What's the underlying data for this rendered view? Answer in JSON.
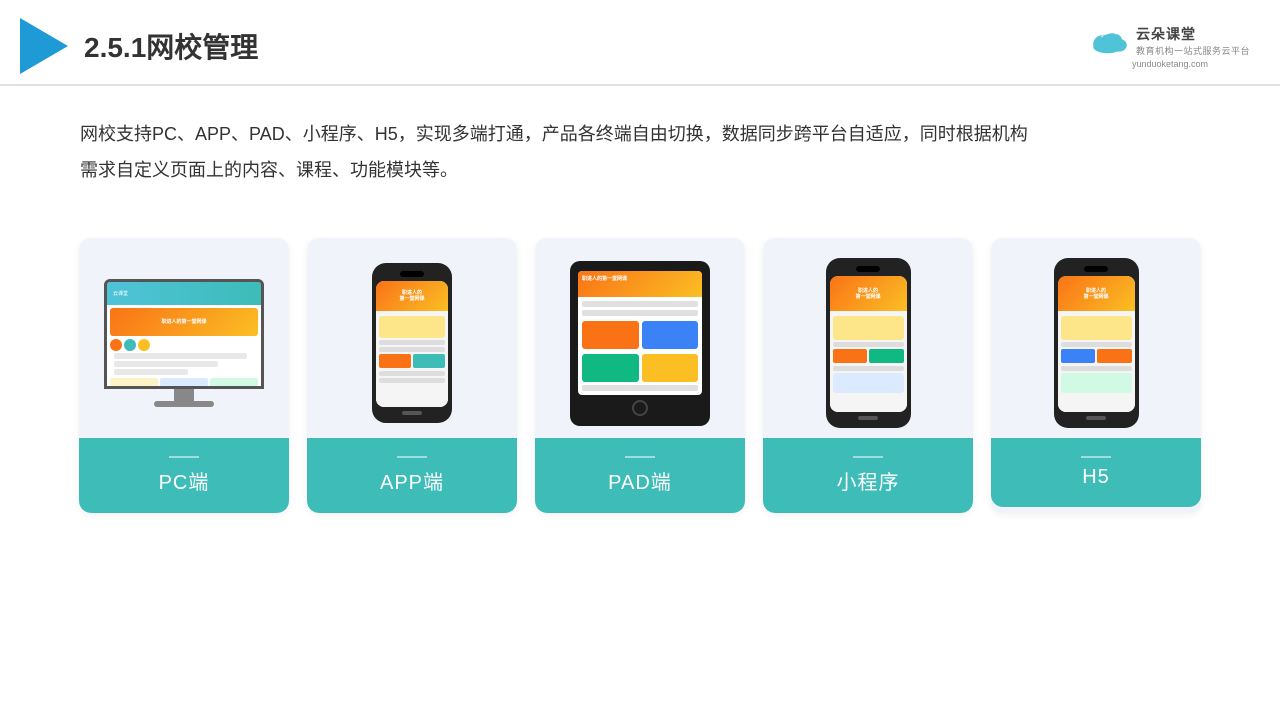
{
  "header": {
    "title": "2.5.1网校管理",
    "brand": {
      "name": "云朵课堂",
      "tagline": "教育机构一站\n式服务云平台",
      "url": "yunduoketang.com"
    }
  },
  "description": "网校支持PC、APP、PAD、小程序、H5，实现多端打通，产品各终端自由切换，数据同步跨平台自适应，同时根据机构\n需求自定义页面上的内容、课程、功能模块等。",
  "cards": [
    {
      "id": "pc",
      "label": "PC端",
      "type": "pc"
    },
    {
      "id": "app",
      "label": "APP端",
      "type": "phone"
    },
    {
      "id": "pad",
      "label": "PAD端",
      "type": "tablet"
    },
    {
      "id": "miniprogram",
      "label": "小程序",
      "type": "phone"
    },
    {
      "id": "h5",
      "label": "H5",
      "type": "phone"
    }
  ],
  "colors": {
    "teal": "#3dbcb8",
    "accent": "#f97316",
    "blue": "#1e9ad6"
  }
}
